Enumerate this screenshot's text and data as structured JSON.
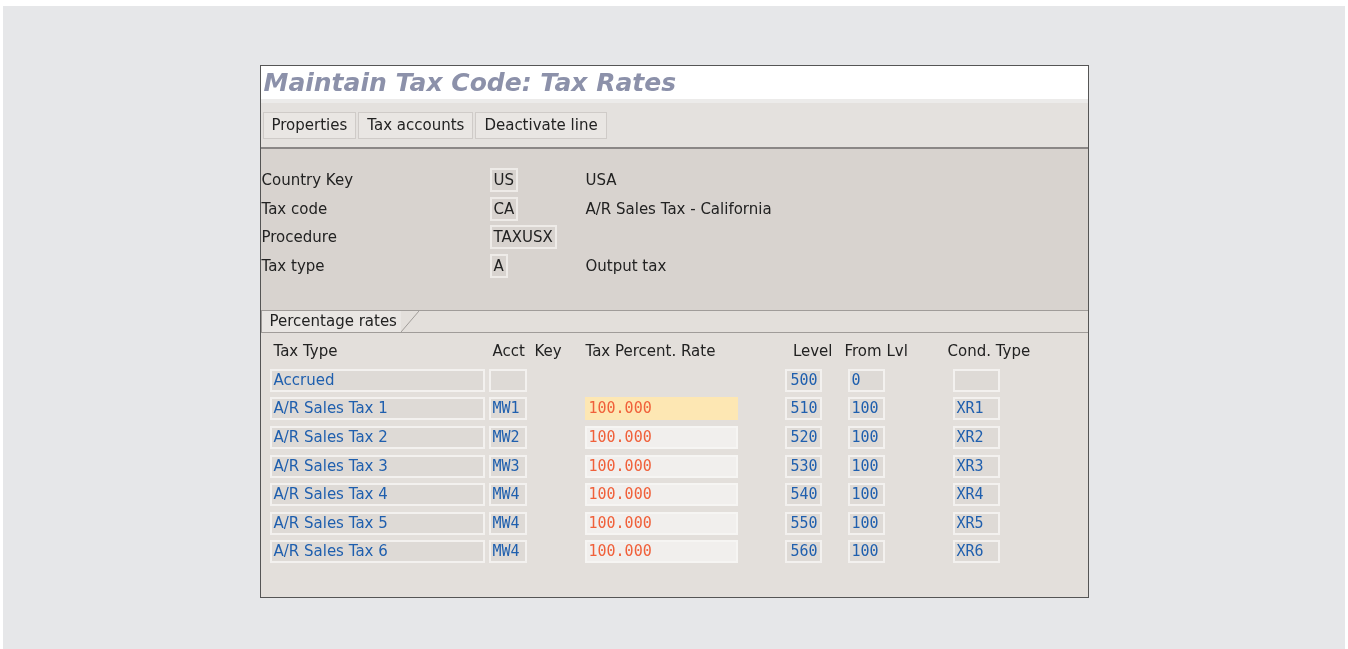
{
  "window": {
    "title": "Maintain Tax Code: Tax Rates"
  },
  "toolbar": [
    "Properties",
    "Tax accounts",
    "Deactivate line"
  ],
  "header_fields": [
    {
      "label": "Country Key",
      "value": "US",
      "description": "USA"
    },
    {
      "label": "Tax code",
      "value": "CA",
      "description": "A/R Sales Tax - California"
    },
    {
      "label": "Procedure",
      "value": "TAXUSX"
    },
    {
      "label": "Tax type",
      "value": "A",
      "description": "Output tax"
    }
  ],
  "tab": {
    "label": "Percentage rates"
  },
  "table": {
    "columns": [
      "Tax  Type",
      "Acct  Key",
      "Tax Percent. Rate",
      "Level",
      "From Lvl",
      "Cond. Type"
    ],
    "rows": [
      {
        "tax_type": "Accrued",
        "level": "500",
        "from_lvl": "0"
      },
      {
        "tax_type": "A/R Sales Tax 1",
        "acct_key": "MW1",
        "rate": {
          "value": "100.000",
          "focused": true
        },
        "level": "510",
        "from_lvl": "100",
        "cond_type": "XR1"
      },
      {
        "tax_type": "A/R Sales Tax 2",
        "acct_key": "MW2",
        "rate": {
          "value": "100.000",
          "focused": false
        },
        "level": "520",
        "from_lvl": "100",
        "cond_type": "XR2"
      },
      {
        "tax_type": "A/R Sales Tax 3",
        "acct_key": "MW3",
        "rate": {
          "value": "100.000",
          "focused": false
        },
        "level": "530",
        "from_lvl": "100",
        "cond_type": "XR3"
      },
      {
        "tax_type": "A/R Sales Tax 4",
        "acct_key": "MW4",
        "rate": {
          "value": "100.000",
          "focused": false
        },
        "level": "540",
        "from_lvl": "100",
        "cond_type": "XR4"
      },
      {
        "tax_type": "A/R Sales Tax 5",
        "acct_key": "MW4",
        "rate": {
          "value": "100.000",
          "focused": false
        },
        "level": "550",
        "from_lvl": "100",
        "cond_type": "XR5"
      },
      {
        "tax_type": "A/R Sales Tax 6",
        "acct_key": "MW4",
        "rate": {
          "value": "100.000",
          "focused": false
        },
        "level": "560",
        "from_lvl": "100",
        "cond_type": "XR6"
      }
    ]
  }
}
